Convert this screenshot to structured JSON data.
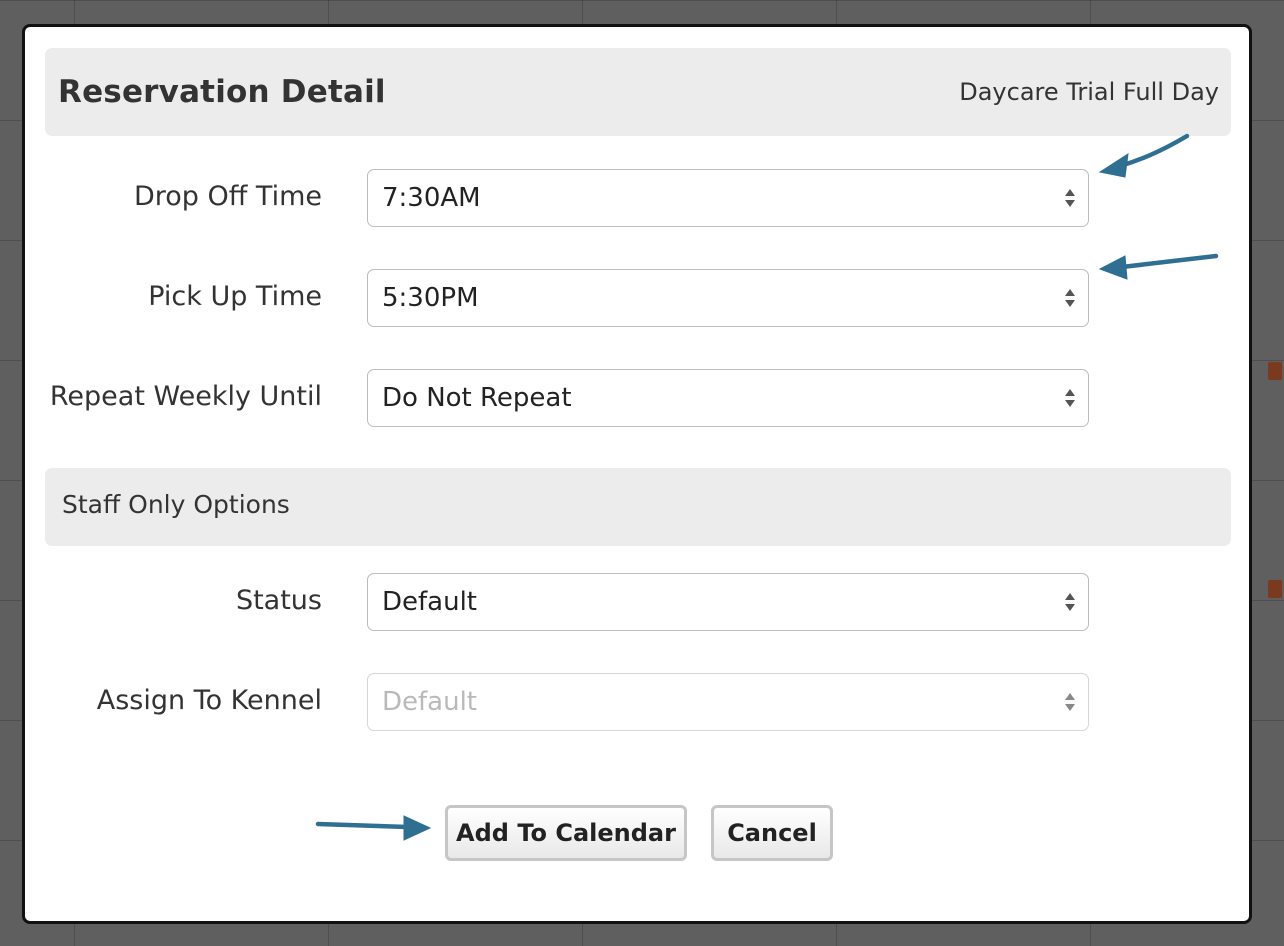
{
  "dialog": {
    "title": "Reservation Detail",
    "service": "Daycare Trial Full Day"
  },
  "fields": {
    "drop_off": {
      "label": "Drop Off Time",
      "value": "7:30AM"
    },
    "pick_up": {
      "label": "Pick Up Time",
      "value": "5:30PM"
    },
    "repeat": {
      "label": "Repeat Weekly Until",
      "value": "Do Not Repeat"
    }
  },
  "staff": {
    "title": "Staff Only Options",
    "status": {
      "label": "Status",
      "value": "Default"
    },
    "kennel": {
      "label": "Assign To Kennel",
      "value": "Default",
      "disabled": true
    }
  },
  "actions": {
    "add_label": "Add To Calendar",
    "cancel_label": "Cancel"
  },
  "colors": {
    "annotation_arrow": "#2f6f91",
    "panel": "#ececec"
  },
  "icons": {
    "select_indicator": "updown-arrows-icon",
    "annotation": "arrow-annotation-icon"
  }
}
